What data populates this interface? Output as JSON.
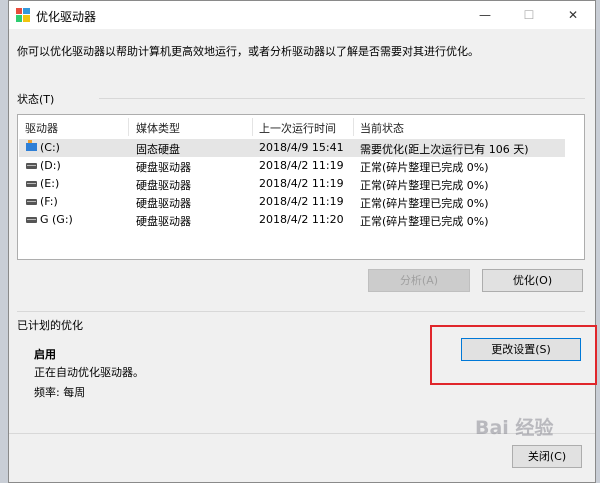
{
  "window": {
    "title": "优化驱动器",
    "minimize": "—",
    "maximize": "☐",
    "close": "✕"
  },
  "intro": "你可以优化驱动器以帮助计算机更高效地运行，或者分析驱动器以了解是否需要对其进行优化。",
  "status": {
    "label": "状态(T)",
    "columns": [
      "驱动器",
      "媒体类型",
      "上一次运行时间",
      "当前状态"
    ],
    "drives": [
      {
        "drive": "(C:)",
        "media": "固态硬盘",
        "last_run": "2018/4/9 15:41",
        "state": "需要优化(距上次运行已有 106 天)",
        "icon": "ssd-drive-icon",
        "selected": true
      },
      {
        "drive": "(D:)",
        "media": "硬盘驱动器",
        "last_run": "2018/4/2 11:19",
        "state": "正常(碎片整理已完成 0%)",
        "icon": "hard-drive-icon"
      },
      {
        "drive": "(E:)",
        "media": "硬盘驱动器",
        "last_run": "2018/4/2 11:19",
        "state": "正常(碎片整理已完成 0%)",
        "icon": "hard-drive-icon"
      },
      {
        "drive": "(F:)",
        "media": "硬盘驱动器",
        "last_run": "2018/4/2 11:19",
        "state": "正常(碎片整理已完成 0%)",
        "icon": "hard-drive-icon"
      },
      {
        "drive": "G (G:)",
        "media": "硬盘驱动器",
        "last_run": "2018/4/2 11:20",
        "state": "正常(碎片整理已完成 0%)",
        "icon": "hard-drive-icon"
      }
    ],
    "analyze_label": "分析(A)",
    "optimize_label": "优化(O)"
  },
  "scheduled": {
    "label": "已计划的优化",
    "state": "启用",
    "description": "正在自动优化驱动器。",
    "frequency": "频率: 每周",
    "change_settings_label": "更改设置(S)"
  },
  "footer": {
    "close_label": "关闭(C)"
  },
  "watermark": "Bai 经验",
  "colors": {
    "highlight_box": "#e0262b",
    "focus": "#0078d7"
  }
}
